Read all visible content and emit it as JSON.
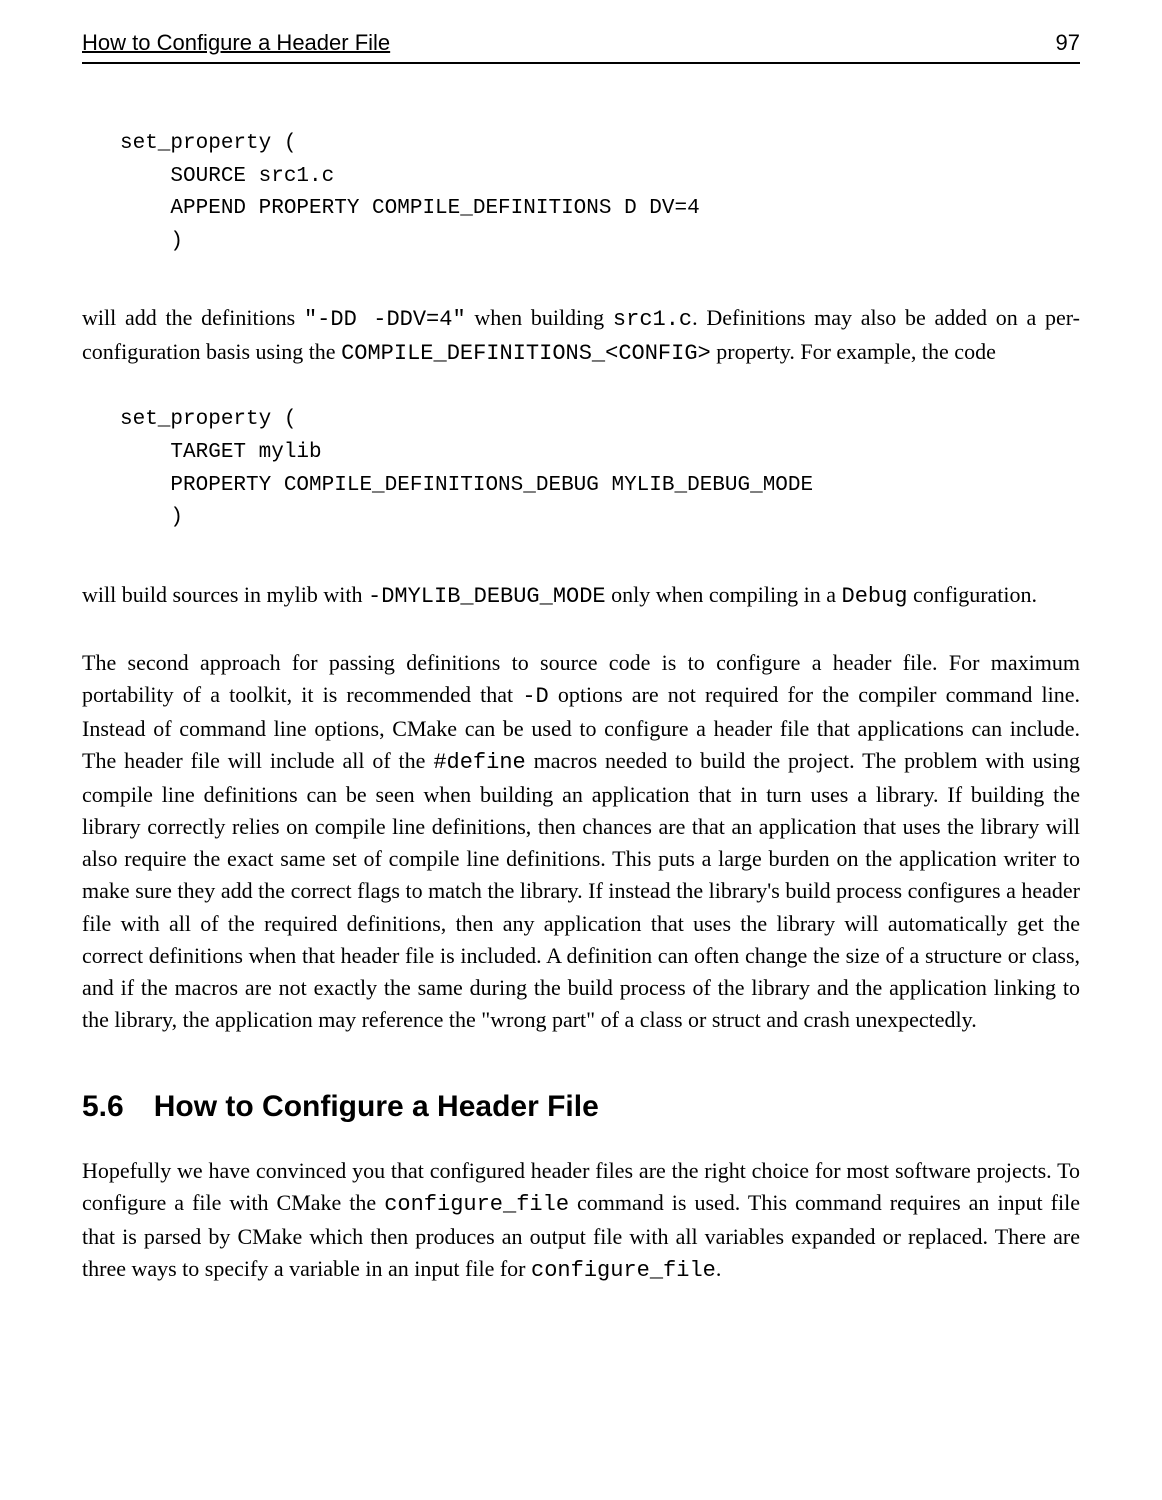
{
  "header": {
    "title": "How to Configure a Header File",
    "page_number": "97"
  },
  "code1": {
    "l1": "set_property (",
    "l2": "    SOURCE src1.c",
    "l3": "    APPEND PROPERTY COMPILE_DEFINITIONS D DV=4",
    "l4": "    )"
  },
  "para1": {
    "t1": "will add the definitions ",
    "c1": "\"-DD -DDV=4\"",
    "t2": " when building ",
    "c2": "src1.c",
    "t3": ". Definitions may also be added on a per-configuration basis using the ",
    "c3": "COMPILE_DEFINITIONS_<CONFIG>",
    "t4": " property. For example, the code"
  },
  "code2": {
    "l1": "set_property (",
    "l2": "    TARGET mylib",
    "l3": "    PROPERTY COMPILE_DEFINITIONS_DEBUG MYLIB_DEBUG_MODE",
    "l4": "    )"
  },
  "para2": {
    "t1": "will build sources in mylib with ",
    "c1": "-DMYLIB_DEBUG_MODE",
    "t2": " only when compiling in a ",
    "c2": "Debug",
    "t3": " configuration."
  },
  "para3": {
    "t1": "The second approach for passing definitions to source code is to configure a header file. For maximum portability of a toolkit, it is recommended that ",
    "c1": "-D",
    "t2": " options are not required for the compiler command line. Instead of command line options, CMake can be used to configure a header file that applications can include. The header file will include all of the ",
    "c2": "#define",
    "t3": " macros needed to build the project. The problem with using compile line definitions can be seen when building an application that in turn uses a library. If building the library correctly relies on compile line definitions, then chances are that an application that uses the library will also require the exact same set of compile line definitions. This puts a large burden on the application writer to make sure they add the correct flags to match the library. If instead the library's build process configures a header file with all of the required definitions, then any application that uses the library will automatically get the correct definitions when that header file is included. A definition can often change the size of a structure or class, and if the macros are not exactly the same during the build process of the library and the application linking to the library, the application may reference the \"wrong part\" of a class or struct and crash unexpectedly."
  },
  "section": {
    "num": "5.6",
    "title": "How to Configure a Header File"
  },
  "para4": {
    "t1": "Hopefully we have convinced you that configured header files are the right choice for most software projects. To configure a file with CMake the ",
    "c1": "configure_file",
    "t2": " command is used. This command requires an input file that is parsed by CMake which then produces an output file with all variables expanded or replaced. There are three ways to specify a variable in an input file for ",
    "c2": "configure_file",
    "t3": "."
  }
}
